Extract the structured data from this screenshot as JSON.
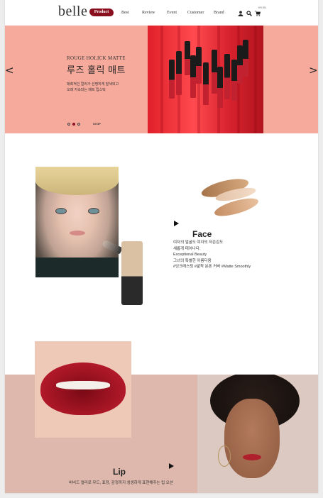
{
  "brand": {
    "logo": "belle"
  },
  "nav": {
    "product": "Product",
    "items": [
      "Best",
      "Review",
      "Event",
      "Customer",
      "Brand"
    ],
    "lang": "KR EN"
  },
  "icons": [
    "user-icon",
    "search-icon",
    "cart-icon",
    "arrow-left-icon",
    "arrow-right-icon",
    "play-icon"
  ],
  "hero": {
    "subtitle": "ROUGE HOLICK MATTE",
    "title": "루즈 홀릭 매트",
    "desc_line1": "매혹적인 컬러가 선명하게 발색되고",
    "desc_line2": "오래 지속되는 매트 립스틱",
    "prev": "<",
    "next": ">",
    "stop": "STOP",
    "active_slide": 2,
    "slide_count": 3
  },
  "face": {
    "title": "Face",
    "lines": [
      "여자의 얼굴도 여자의 자존감도",
      "새롭게 태어나다.",
      "Exceptional Beauty",
      "그녀의 특별한 아름다움",
      "#잉크래스팅 #얇착 분폰 커버 #Matte Smoothly"
    ]
  },
  "lip": {
    "title": "Lip",
    "desc": "비비드 컬러로 무드, 표정, 감정까지 생생하게 표현해주는 립 오션"
  },
  "colors": {
    "accent": "#8a0f1e",
    "hero_bg": "#f5aa9c",
    "lip_band": "#deb8ad"
  }
}
